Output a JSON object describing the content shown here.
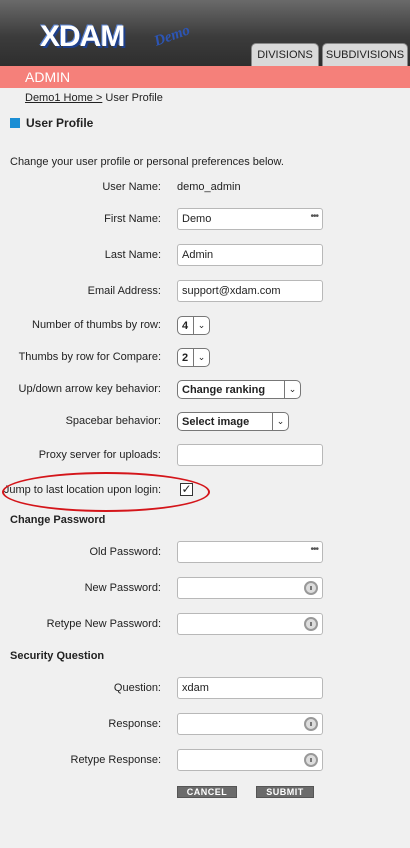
{
  "header": {
    "logo": "XDAM",
    "logo_sub": "Demo",
    "tabs": [
      "DIVISIONS",
      "SUBDIVISIONS"
    ]
  },
  "admin_bar": "ADMIN",
  "breadcrumb": {
    "home": "Demo1 Home >",
    "current": "User Profile"
  },
  "page_title": "User Profile",
  "intro": "Change your user profile or personal preferences below.",
  "profile": {
    "username_label": "User Name:",
    "username": "demo_admin",
    "first_name_label": "First Name:",
    "first_name": "Demo",
    "last_name_label": "Last Name:",
    "last_name": "Admin",
    "email_label": "Email Address:",
    "email": "support@xdam.com",
    "thumbs_label": "Number of thumbs by row:",
    "thumbs": "4",
    "compare_label": "Thumbs by row for Compare:",
    "compare": "2",
    "arrow_label": "Up/down arrow key behavior:",
    "arrow": "Change ranking",
    "space_label": "Spacebar behavior:",
    "space": "Select image",
    "proxy_label": "Proxy server for uploads:",
    "proxy": "",
    "jump_label": "Jump to last location upon login:",
    "jump_checked": true
  },
  "password": {
    "section": "Change Password",
    "old_label": "Old Password:",
    "new_label": "New Password:",
    "retype_label": "Retype New Password:"
  },
  "security": {
    "section": "Security Question",
    "question_label": "Question:",
    "question": "xdam",
    "response_label": "Response:",
    "retype_label": "Retype Response:"
  },
  "buttons": {
    "cancel": "CANCEL",
    "submit": "SUBMIT"
  },
  "colors": {
    "admin_bar": "#f5807a",
    "highlight": "#d4151a",
    "title_square": "#1b8ed4"
  }
}
